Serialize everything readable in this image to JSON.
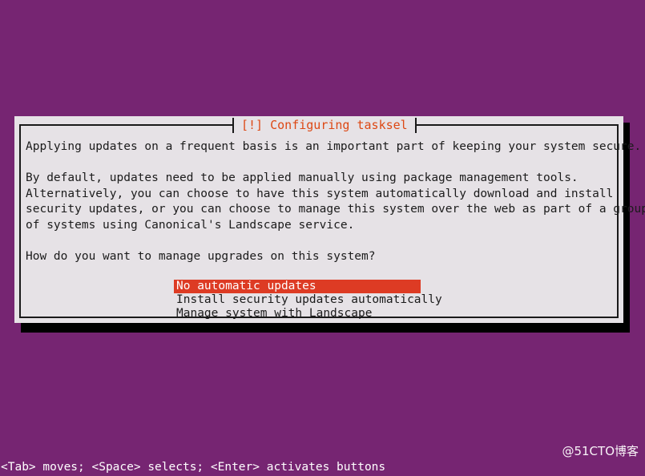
{
  "screen": {
    "background_color": "#762572"
  },
  "dialog": {
    "title": "[!] Configuring tasksel",
    "title_color": "#dd4814",
    "background_color": "#e6e2e6",
    "border_color": "#1a1a1a",
    "paragraphs": {
      "intro": "Applying updates on a frequent basis is an important part of keeping your system secure.",
      "detail": "By default, updates need to be applied manually using package management tools.\nAlternatively, you can choose to have this system automatically download and install\nsecurity updates, or you can choose to manage this system over the web as part of a group\nof systems using Canonical's Landscape service.",
      "question": "How do you want to manage upgrades on this system?"
    },
    "choices": [
      {
        "label": "No automatic updates",
        "selected": true
      },
      {
        "label": "Install security updates automatically",
        "selected": false
      },
      {
        "label": "Manage system with Landscape",
        "selected": false
      }
    ],
    "highlight_color": "#dd3b24",
    "highlight_text_color": "#ffffff"
  },
  "status_bar": {
    "hint": "<Tab> moves; <Space> selects; <Enter> activates buttons"
  },
  "watermark": {
    "text": "@51CTO博客"
  }
}
